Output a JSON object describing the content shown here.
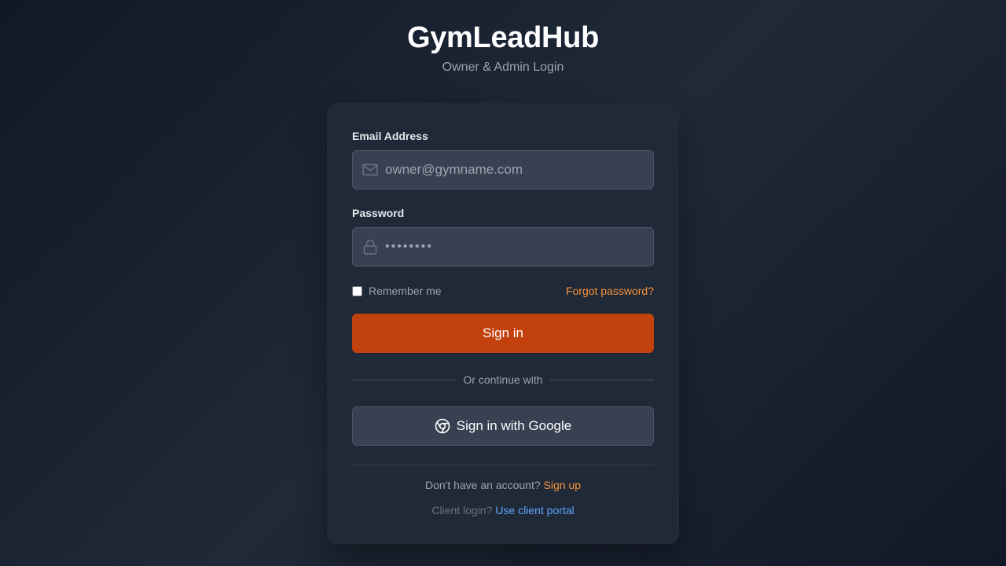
{
  "header": {
    "title": "GymLeadHub",
    "subtitle": "Owner & Admin Login"
  },
  "form": {
    "email_label": "Email Address",
    "email_placeholder": "owner@gymname.com",
    "email_icon": "mail-icon",
    "password_label": "Password",
    "password_value": "••••••••",
    "password_icon": "lock-icon",
    "remember_label": "Remember me",
    "remember_checked": false,
    "forgot_label": "Forgot password?",
    "signin_label": "Sign in",
    "divider_text": "Or continue with",
    "google_label": "Sign in with Google",
    "google_icon": "chrome-icon"
  },
  "footer": {
    "signup_prompt": "Don't have an account?",
    "signup_link": "Sign up",
    "client_prompt": "Client login?",
    "client_link": "Use client portal"
  },
  "colors": {
    "accent": "#c2410c",
    "link_orange": "#fb923c",
    "link_blue": "#60a5fa",
    "card_bg": "#1f2937",
    "input_bg": "#374151"
  }
}
